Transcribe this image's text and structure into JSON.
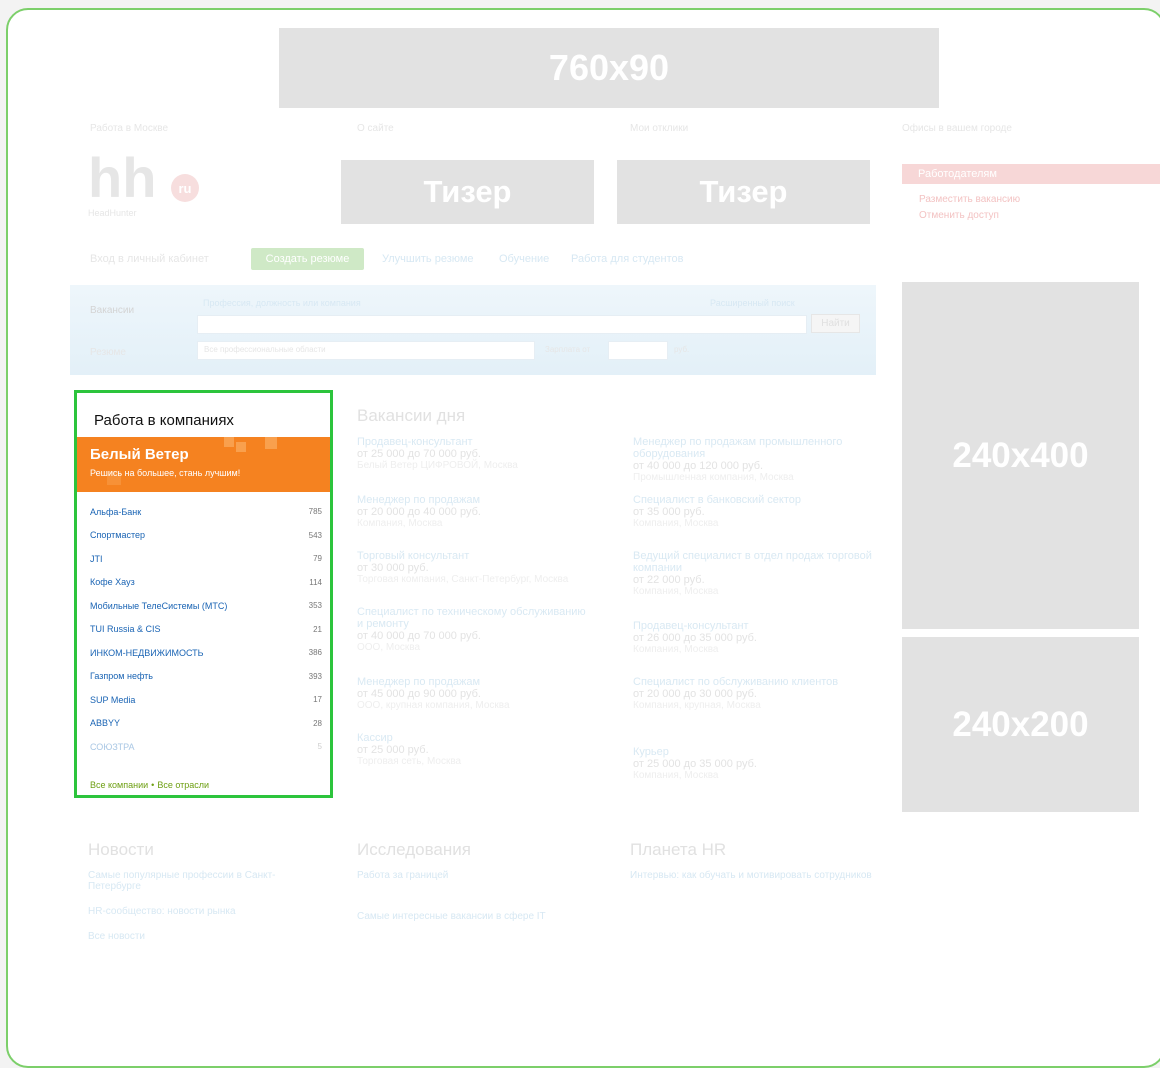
{
  "banners": {
    "top": "760x90",
    "teaser1": "Тизер",
    "teaser2": "Тизер",
    "side_big": "240x400",
    "side_small": "240x200"
  },
  "logo": {
    "text": "hh",
    "badge": "ru",
    "tagline": "HeadHunter"
  },
  "top_links": [
    "Работа в Москве",
    "О сайте",
    "Мои отклики",
    "Офисы в вашем городе"
  ],
  "employer_box": {
    "title": "Работодателям",
    "links": [
      "Разместить вакансию",
      "Отменить доступ"
    ]
  },
  "nav": {
    "login": "Вход в личный кабинет",
    "create_resume": "Создать резюме",
    "links": [
      "Улучшить резюме",
      "Обучение",
      "Работа для студентов"
    ]
  },
  "search": {
    "tab_vacancies": "Вакансии",
    "tab_resumes": "Резюме",
    "placeholder": "Профессия, должность или компания",
    "advanced": "Расширенный поиск",
    "find_button": "Найти",
    "area_select": "Все профессиональные области",
    "salary_label": "Зарплата от",
    "currency": "руб."
  },
  "companies": {
    "title": "Работа в компаниях",
    "promo_name": "Белый Ветер",
    "promo_slogan": "Решись на большее, стань лучшим!",
    "items": [
      {
        "name": "Альфа-Банк",
        "count": "785"
      },
      {
        "name": "Спортмастер",
        "count": "543"
      },
      {
        "name": "JTI",
        "count": "79"
      },
      {
        "name": "Кофе Хауз",
        "count": "114"
      },
      {
        "name": "Мобильные ТелеСистемы (МТС)",
        "count": "353"
      },
      {
        "name": "TUI Russia & CIS",
        "count": "21"
      },
      {
        "name": "ИНКОМ-НЕДВИЖИМОСТЬ",
        "count": "386"
      },
      {
        "name": "Газпром нефть",
        "count": "393"
      },
      {
        "name": "SUP Media",
        "count": "17"
      },
      {
        "name": "ABBYY",
        "count": "28"
      },
      {
        "name": "СОЮЗТРА",
        "count": "5"
      }
    ],
    "all_companies": "Все компании",
    "all_industries": "Все отрасли"
  },
  "vacancies": {
    "title": "Вакансии дня",
    "left": [
      {
        "title": "Продавец-консультант",
        "salary": "от 25 000 до 70 000 руб.",
        "sub": "Белый Ветер ЦИФРОВОЙ, Москва"
      },
      {
        "title": "Менеджер по продажам",
        "salary": "от 20 000 до 40 000 руб.",
        "sub": "Компания, Москва"
      },
      {
        "title": "Торговый консультант",
        "salary": "от 30 000 руб.",
        "sub": "Торговая компания, Санкт-Петербург, Москва"
      },
      {
        "title": "Специалист по техническому обслуживанию и ремонту",
        "salary": "от 40 000 до 70 000 руб.",
        "sub": "ООО, Москва"
      },
      {
        "title": "Менеджер по продажам",
        "salary": "от 45 000 до 90 000 руб.",
        "sub": "ООО, крупная компания, Москва"
      },
      {
        "title": "Кассир",
        "salary": "от 25 000 руб.",
        "sub": "Торговая сеть, Москва"
      }
    ],
    "right": [
      {
        "title": "Менеджер по продажам промышленного оборудования",
        "salary": "от 40 000 до 120 000 руб.",
        "sub": "Промышленная компания, Москва"
      },
      {
        "title": "Специалист в банковский сектор",
        "salary": "от 35 000 руб.",
        "sub": "Компания, Москва"
      },
      {
        "title": "Ведущий специалист в отдел продаж торговой компании",
        "salary": "от 22 000 руб.",
        "sub": "Компания, Москва"
      },
      {
        "title": "Продавец-консультант",
        "salary": "от 26 000 до 35 000 руб.",
        "sub": "Компания, Москва"
      },
      {
        "title": "Специалист по обслуживанию клиентов",
        "salary": "от 20 000 до 30 000 руб.",
        "sub": "Компания, крупная, Москва"
      },
      {
        "title": "Курьер",
        "salary": "от 25 000 до 35 000 руб.",
        "sub": "Компания, Москва"
      }
    ]
  },
  "bottom": {
    "news_title": "Новости",
    "news": [
      "Самые популярные профессии в Санкт-Петербурге",
      "HR-сообщество: новости рынка",
      "Все новости"
    ],
    "research_title": "Исследования",
    "research": [
      "Работа за границей",
      "Самые интересные вакансии в сфере IT"
    ],
    "planet_title": "Планета HR",
    "planet": [
      "Интервью: как обучать и мотивировать сотрудников"
    ]
  }
}
